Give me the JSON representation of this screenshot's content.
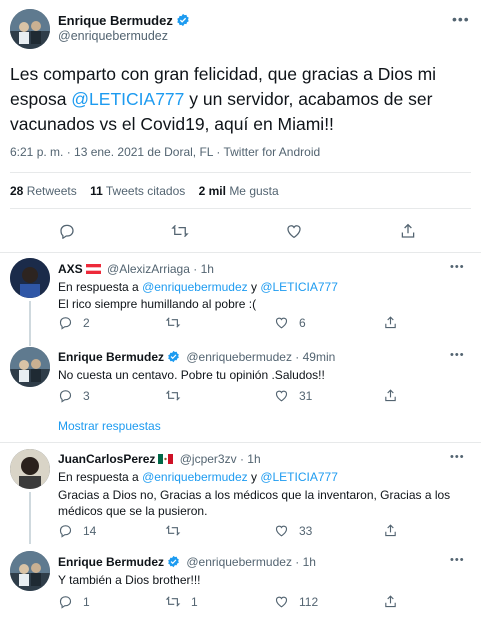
{
  "main_tweet": {
    "name": "Enrique Bermudez",
    "handle": "@enriquebermudez",
    "text_part1": "Les comparto con gran felicidad, que gracias a Dios mi esposa ",
    "text_mention": "@LETICIA777",
    "text_part2": " y un servidor, acabamos de ser vacunados vs el Covid19, aquí en Miami!!",
    "meta": "6:21 p. m. · 13 ene. 2021 de Doral, FL · Twitter for Android",
    "stats": {
      "retweets_count": "28",
      "retweets_label": "Retweets",
      "quotes_count": "11",
      "quotes_label": "Tweets citados",
      "likes_count": "2 mil",
      "likes_label": "Me gusta"
    }
  },
  "replies": [
    {
      "name": "AXS",
      "handle": "@AlexizArriaga",
      "time": "· 1h",
      "reply_prefix": "En respuesta a ",
      "reply_user1": "@enriquebermudez",
      "reply_and": " y ",
      "reply_user2": "@LETICIA777",
      "text": "El rico siempre humillando al pobre :(",
      "replies": "2",
      "retweets": "",
      "likes": "6"
    },
    {
      "name": "Enrique Bermudez",
      "handle": "@enriquebermudez",
      "time": "· 49min",
      "text": "No cuesta un centavo. Pobre tu opinión  .Saludos!!",
      "replies": "3",
      "retweets": "",
      "likes": "31"
    },
    {
      "name": "JuanCarlosPerez",
      "handle": "@jcper3zv",
      "time": "· 1h",
      "reply_prefix": "En respuesta a ",
      "reply_user1": "@enriquebermudez",
      "reply_and": " y ",
      "reply_user2": "@LETICIA777",
      "text": "Gracias a Dios no, Gracias a los médicos que la inventaron, Gracias a los médicos que se la pusieron.",
      "replies": "14",
      "retweets": "",
      "likes": "33"
    },
    {
      "name": "Enrique Bermudez",
      "handle": "@enriquebermudez",
      "time": "· 1h",
      "text": "Y también  a Dios brother!!!",
      "replies": "1",
      "retweets": "1",
      "likes": "112"
    }
  ],
  "show_replies_label": "Mostrar respuestas",
  "colors": {
    "accent": "#1d9bf0",
    "muted": "#536471",
    "divider": "#e7e9ea",
    "verified": "#1d9bf0"
  }
}
